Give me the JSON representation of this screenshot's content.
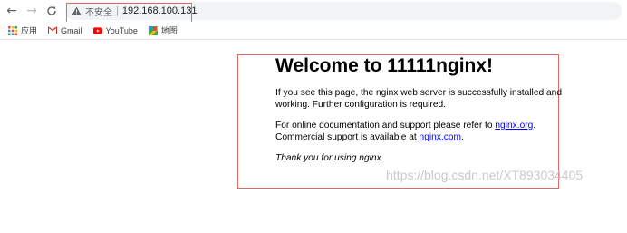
{
  "toolbar": {
    "back_glyph": "←",
    "forward_glyph": "→",
    "reload_glyph": "C",
    "security_label": "不安全",
    "separator": "|",
    "url": "192.168.100.131"
  },
  "bookmarks": [
    {
      "label": "应用",
      "icon": "apps-grid-icon"
    },
    {
      "label": "Gmail",
      "icon": "gmail-icon"
    },
    {
      "label": "YouTube",
      "icon": "youtube-icon"
    },
    {
      "label": "地图",
      "icon": "maps-icon"
    }
  ],
  "page": {
    "heading": "Welcome to 11111nginx!",
    "para1": "If you see this page, the nginx web server is successfully installed and working. Further configuration is required.",
    "para2_prefix": "For online documentation and support please refer to ",
    "link1": "nginx.org",
    "para2_mid": ".",
    "para2_line2_prefix": "Commercial support is available at ",
    "link2": "nginx.com",
    "para2_suffix": ".",
    "thanks": "Thank you for using nginx."
  },
  "watermark": "https://blog.csdn.net/XT893034405",
  "colors": {
    "highlight": "#e06a6a",
    "link": "#0000ee",
    "gmail_red": "#d93025",
    "youtube_red": "#ff0000"
  }
}
